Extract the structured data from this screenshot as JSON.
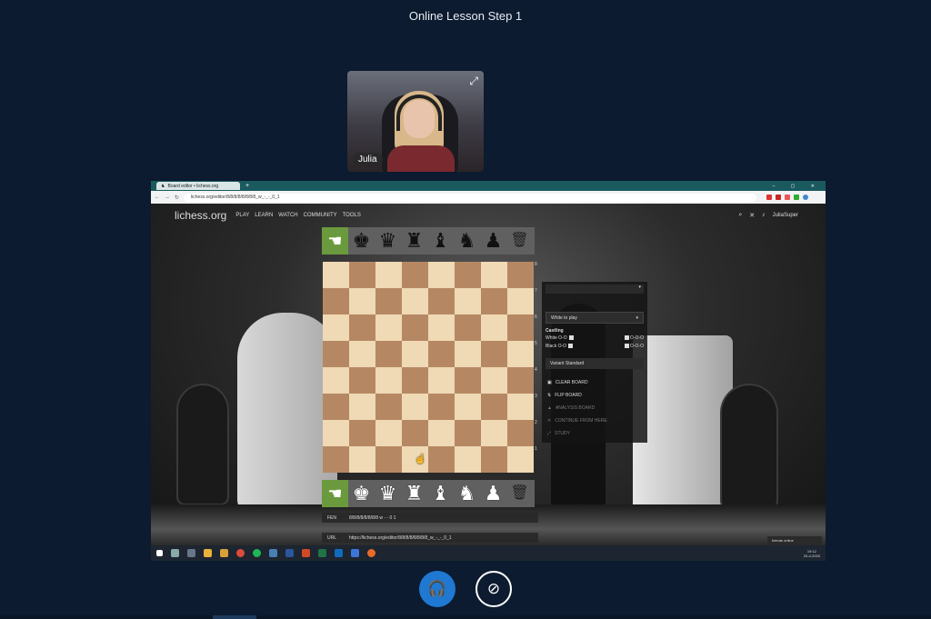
{
  "call": {
    "title": "Online Lesson Step 1",
    "participant": {
      "name": "Julia"
    },
    "controls": {
      "audio_icon": "headset-icon",
      "video_icon": "video-off-icon"
    }
  },
  "browser": {
    "tab_title": "Board editor • lichess.org",
    "url": "lichess.org/editor/8/8/8/8/8/8/8/8_w_-_-_0_1"
  },
  "site": {
    "logo": "lichess.org",
    "nav": [
      "PLAY",
      "LEARN",
      "WATCH",
      "COMMUNITY",
      "TOOLS"
    ],
    "user": "JuliaSuper"
  },
  "editor": {
    "turn_select": "White to play",
    "castling": {
      "title": "Castling",
      "white_label": "White O-O",
      "black_label": "Black O-O",
      "long_label": "O-O-O"
    },
    "variant": "Variant   Standard",
    "actions": [
      {
        "label": "CLEAR BOARD",
        "dim": false
      },
      {
        "label": "FLIP BOARD",
        "dim": false
      },
      {
        "label": "ANALYSIS BOARD",
        "dim": true
      },
      {
        "label": "CONTINUE FROM HERE",
        "dim": true
      },
      {
        "label": "STUDY",
        "dim": true
      }
    ],
    "fen_label": "FEN",
    "fen_value": "8/8/8/8/8/8/8/8 w - - 0 1",
    "url_label": "URL",
    "url_value": "https://lichess.org/editor/8/8/8/8/8/8/8/8_w_-_-_0_1",
    "rank_labels": [
      "8",
      "7",
      "6",
      "5",
      "4",
      "3",
      "2",
      "1"
    ],
    "friends": "friends online"
  },
  "taskbar": {
    "time": "19:12",
    "date": "20-4-2020"
  },
  "colors": {
    "background": "#0c1b2f",
    "accent": "#1f78d1",
    "board_light": "#f0d9b5",
    "board_dark": "#b58863",
    "palette_active": "#6a9a3d"
  }
}
